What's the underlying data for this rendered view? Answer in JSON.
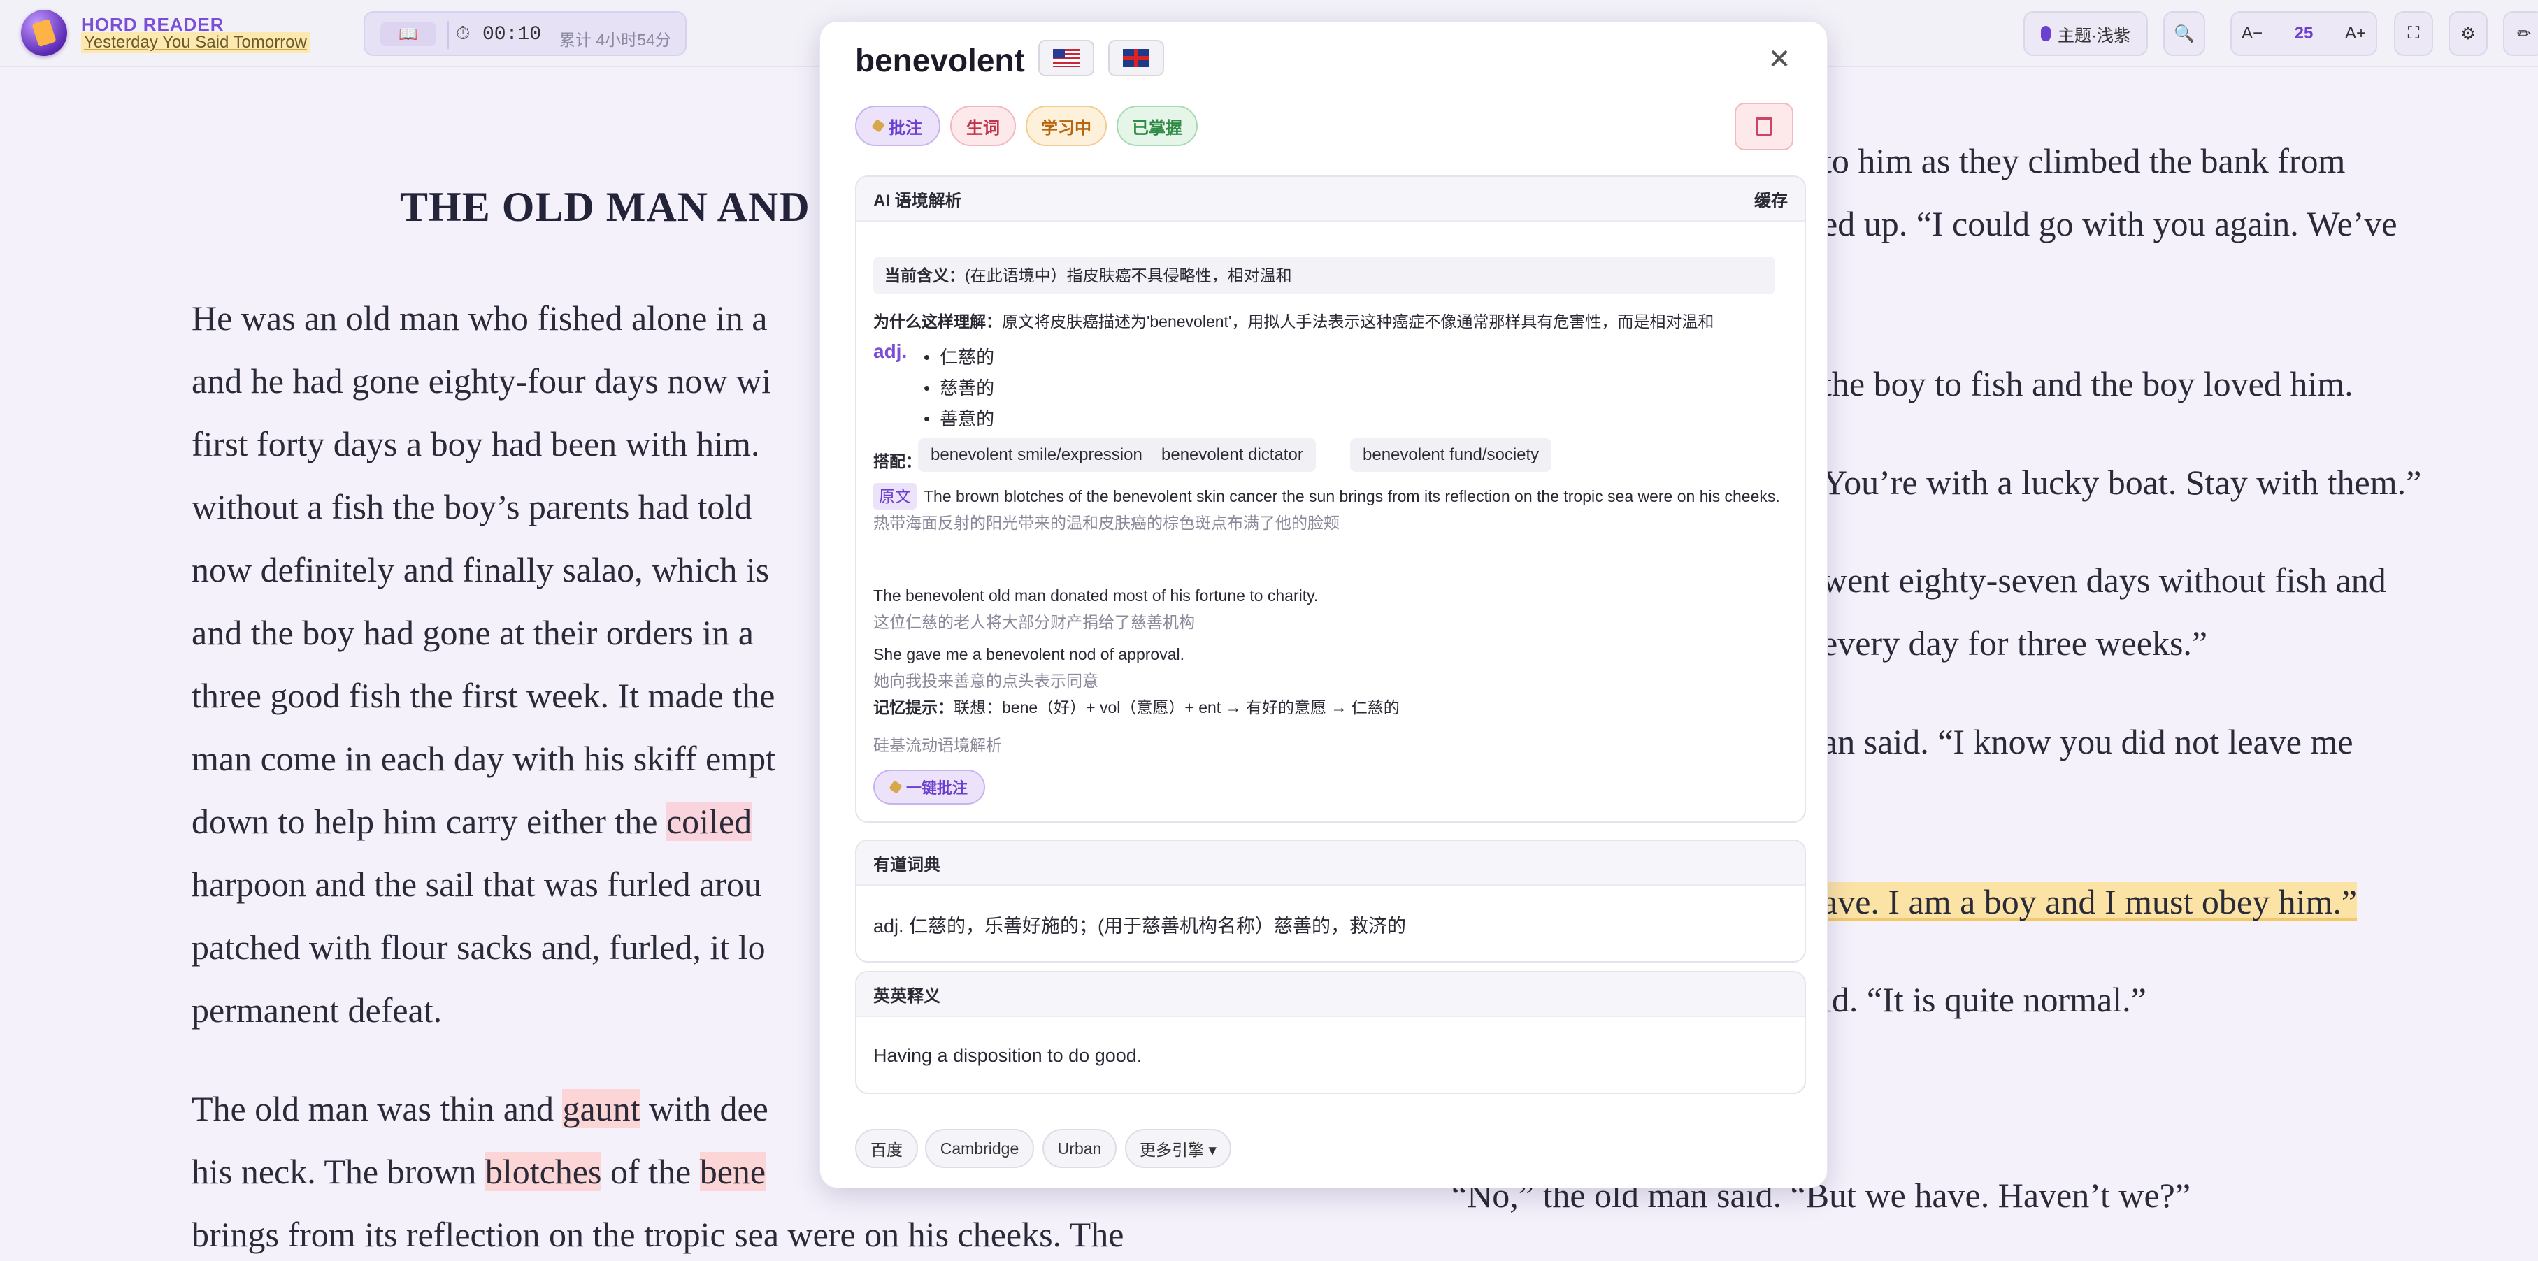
{
  "app": {
    "name": "HORD READER",
    "book": "Yesterday You Said Tomorrow"
  },
  "timer": {
    "elapsed": "00:10",
    "total": "累计 4小时54分"
  },
  "toolbar": {
    "theme": "主题·浅紫",
    "font_decrease": "A−",
    "font_size": "25",
    "font_increase": "A+"
  },
  "book": {
    "title": "THE OLD MAN AND",
    "left_lines": [
      "He was an old man who fished alone in a",
      "and he had gone eighty-four days now wi",
      "first forty days a boy had been with him.",
      "without a fish the boy’s parents had told",
      "now definitely and finally salao, which is",
      "and the boy had gone at their orders in a",
      "three good fish the first week. It made the",
      "man come in each day with his skiff empt",
      "down to help him carry either the ",
      "harpoon and the sail that was furled arou",
      "patched with flour sacks and, furled, it lo",
      "permanent defeat."
    ],
    "coiled": "coiled",
    "p2": {
      "l1a": "The old man was thin and ",
      "gaunt": "gaunt",
      "l1b": " with dee",
      "l2a": "his neck. The brown ",
      "blotches": "blotches",
      "l2b": " of the ",
      "bene": "bene",
      "l3": "brings from its reflection on the tropic sea were on his cheeks. The"
    },
    "right_lines": [
      "to him as they climbed the bank from",
      "ed up. “I could go with you again. We’ve",
      "the boy to fish and the boy loved him.",
      "You’re with a lucky boat. Stay with them.”",
      "went eighty-seven days without fish and",
      "every day for three weeks.”",
      "an said. “I know you did not leave me",
      "ave. I am a boy and I must obey him.”",
      "id. “It is quite normal.”",
      "“No,” the old man said. “But we have. Haven’t we?”"
    ]
  },
  "popup": {
    "word": "benevolent",
    "tags": {
      "note": "批注",
      "new": "生词",
      "learning": "学习中",
      "mastered": "已掌握"
    },
    "ai": {
      "header": "AI 语境解析",
      "cache": "缓存",
      "current_label": "当前含义：",
      "current": "(在此语境中）指皮肤癌不具侵略性，相对温和",
      "why_label": "为什么这样理解：",
      "why": "原文将皮肤癌描述为'benevolent'，用拟人手法表示这种癌症不像通常那样具有危害性，而是相对温和",
      "pos": "adj.",
      "meanings": [
        "仁慈的",
        "慈善的",
        "善意的"
      ],
      "collocation_label": "搭配：",
      "collocations": [
        "benevolent smile/expression",
        "benevolent dictator",
        "benevolent fund/society"
      ],
      "orig_tag": "原文",
      "examples": [
        {
          "en": "The brown blotches of the benevolent skin cancer the sun brings from its reflection on the tropic sea were on his cheeks.",
          "zh": "热带海面反射的阳光带来的温和皮肤癌的棕色斑点布满了他的脸颊"
        },
        {
          "en": "The benevolent old man donated most of his fortune to charity.",
          "zh": "这位仁慈的老人将大部分财产捐给了慈善机构"
        },
        {
          "en": "She gave me a benevolent nod of approval.",
          "zh": "她向我投来善意的点头表示同意"
        }
      ],
      "memory_label": "记忆提示：",
      "memory": "联想：bene（好）+ vol（意愿）+ ent → 有好的意愿 → 仁慈的",
      "source": "硅基流动语境解析",
      "annotate_all": "一键批注"
    },
    "youdao": {
      "header": "有道词典",
      "def": "adj. 仁慈的，乐善好施的；(用于慈善机构名称）慈善的，救济的"
    },
    "english": {
      "header": "英英释义",
      "def": "Having a disposition to do good."
    },
    "engines": [
      "百度",
      "Cambridge",
      "Urban",
      "更多引擎 ▾"
    ]
  },
  "colors": {
    "accent": "#7a4fd6",
    "highlight_yellow": "#fbe3a6",
    "highlight_pink": "#f9d4dc"
  }
}
